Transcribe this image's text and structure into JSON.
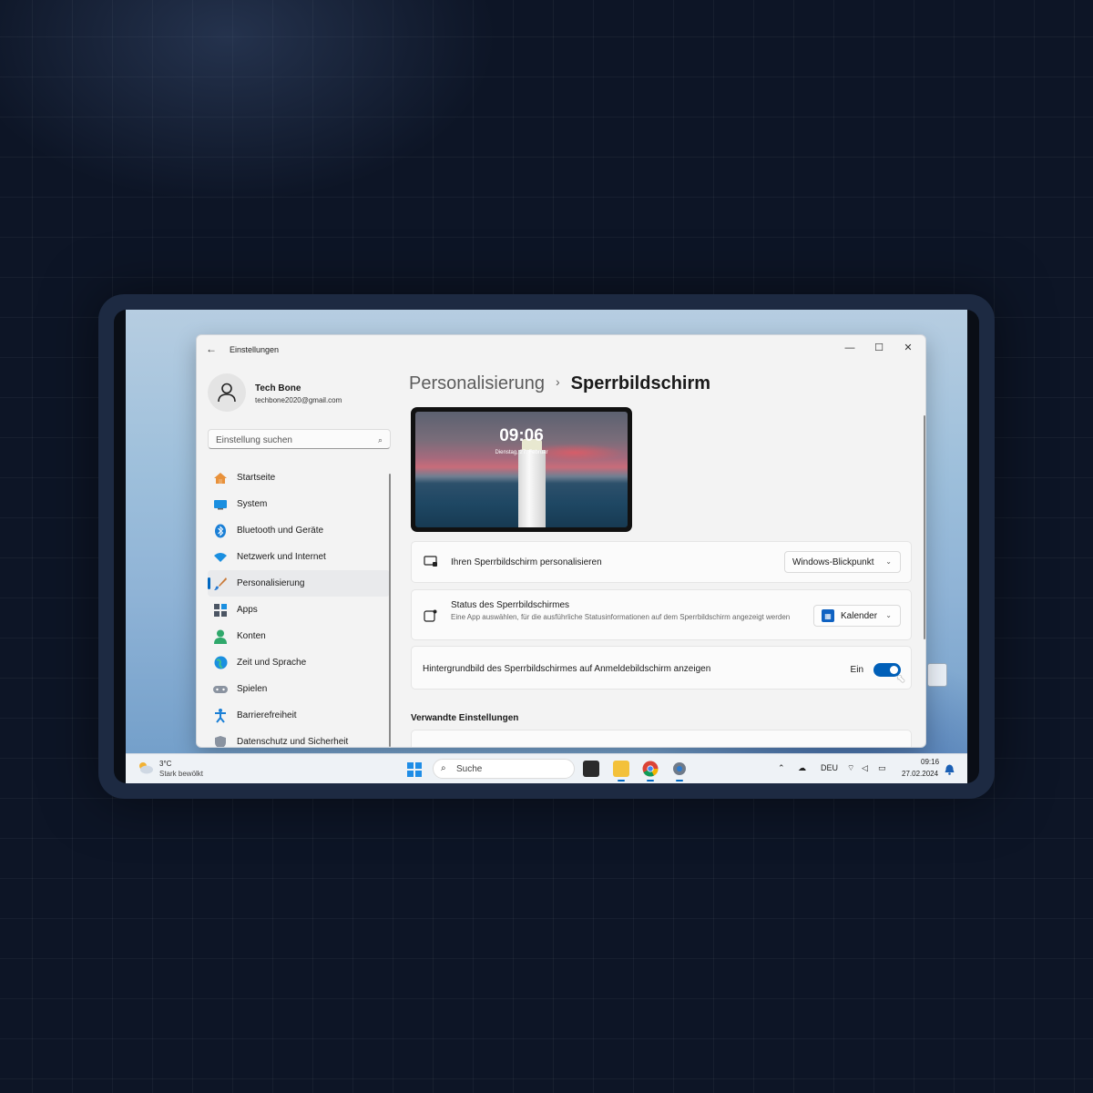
{
  "window": {
    "title": "Einstellungen"
  },
  "profile": {
    "name": "Tech Bone",
    "email": "techbone2020@gmail.com"
  },
  "search": {
    "placeholder": "Einstellung suchen"
  },
  "sidebar": {
    "items": [
      {
        "label": "Startseite",
        "icon": "home-icon"
      },
      {
        "label": "System",
        "icon": "system-icon"
      },
      {
        "label": "Bluetooth und Geräte",
        "icon": "bluetooth-icon"
      },
      {
        "label": "Netzwerk und Internet",
        "icon": "network-icon"
      },
      {
        "label": "Personalisierung",
        "icon": "brush-icon",
        "active": true
      },
      {
        "label": "Apps",
        "icon": "apps-icon"
      },
      {
        "label": "Konten",
        "icon": "account-icon"
      },
      {
        "label": "Zeit und Sprache",
        "icon": "globe-icon"
      },
      {
        "label": "Spielen",
        "icon": "gamepad-icon"
      },
      {
        "label": "Barrierefreiheit",
        "icon": "accessibility-icon"
      },
      {
        "label": "Datenschutz und Sicherheit",
        "icon": "shield-icon"
      }
    ]
  },
  "breadcrumb": {
    "parent": "Personalisierung",
    "separator": "›",
    "current": "Sperrbildschirm"
  },
  "preview": {
    "time": "09:06",
    "date": "Dienstag, 27. Februar"
  },
  "settings": {
    "personalize": {
      "title": "Ihren Sperrbildschirm personalisieren",
      "value": "Windows-Blickpunkt"
    },
    "status": {
      "title": "Status des Sperrbildschirmes",
      "subtitle": "Eine App auswählen, für die ausführliche Statusinformationen auf dem Sperrbildschirm angezeigt werden",
      "value": "Kalender"
    },
    "background": {
      "title": "Hintergrundbild des Sperrbildschirmes auf Anmeldebildschirm anzeigen",
      "state": "Ein",
      "on": true
    }
  },
  "related": {
    "title": "Verwandte Einstellungen"
  },
  "taskbar": {
    "weather_temp": "3°C",
    "weather_desc": "Stark bewölkt",
    "search_label": "Suche",
    "language": "DEU",
    "time": "09:16",
    "date": "27.02.2024"
  },
  "colors": {
    "accent": "#0067c0",
    "toggle_on": "#005fb8"
  }
}
